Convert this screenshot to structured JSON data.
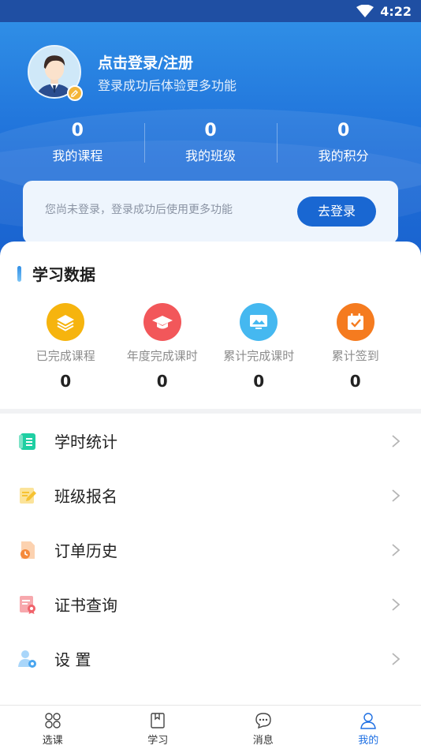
{
  "status": {
    "time": "4:22"
  },
  "header": {
    "title": "点击登录/注册",
    "subtitle": "登录成功后体验更多功能"
  },
  "stats": [
    {
      "value": "0",
      "label": "我的课程"
    },
    {
      "value": "0",
      "label": "我的班级"
    },
    {
      "value": "0",
      "label": "我的积分"
    }
  ],
  "login_card": {
    "tip": "您尚未登录，登录成功后使用更多功能",
    "button": "去登录"
  },
  "learning": {
    "title": "学习数据",
    "metrics": [
      {
        "label": "已完成课程",
        "value": "0",
        "icon": "layers-icon",
        "color": "#f6b40e"
      },
      {
        "label": "年度完成课时",
        "value": "0",
        "icon": "graduation-cap-icon",
        "color": "#f2575a"
      },
      {
        "label": "累计完成课时",
        "value": "0",
        "icon": "monitor-icon",
        "color": "#45b8f0"
      },
      {
        "label": "累计签到",
        "value": "0",
        "icon": "calendar-check-icon",
        "color": "#f57b1f"
      }
    ]
  },
  "menu": [
    {
      "label": "学时统计",
      "icon": "notebook-icon",
      "color": "#1fcfa3"
    },
    {
      "label": "班级报名",
      "icon": "edit-note-icon",
      "color": "#f6c232"
    },
    {
      "label": "订单历史",
      "icon": "order-clock-icon",
      "color": "#f58a3c"
    },
    {
      "label": "证书查询",
      "icon": "certificate-icon",
      "color": "#f0636b"
    },
    {
      "label": "设 置",
      "icon": "user-settings-icon",
      "color": "#4aa6ef"
    }
  ],
  "tabs": [
    {
      "label": "选课",
      "icon": "grid-icon",
      "active": false
    },
    {
      "label": "学习",
      "icon": "book-icon",
      "active": false
    },
    {
      "label": "消息",
      "icon": "message-icon",
      "active": false
    },
    {
      "label": "我的",
      "icon": "profile-icon",
      "active": true
    }
  ],
  "colors": {
    "primary": "#1967d2",
    "active_tab": "#1d6fe3"
  }
}
